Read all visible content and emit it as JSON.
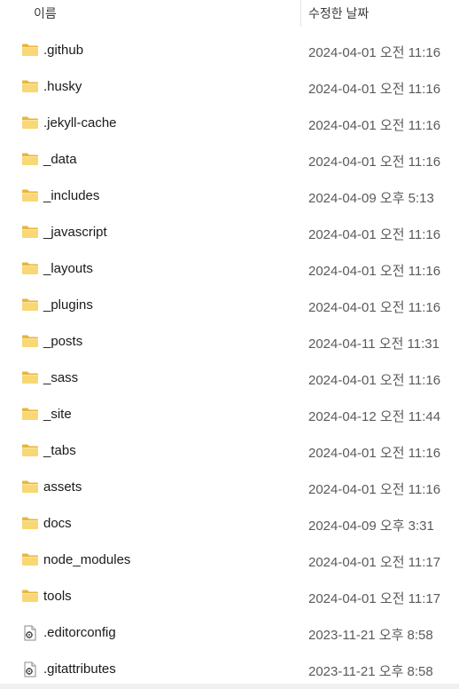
{
  "header": {
    "name_label": "이름",
    "date_label": "수정한 날짜",
    "sort_indicator": "^"
  },
  "rows": [
    {
      "name": ".github",
      "date": "2024-04-01 오전 11:16",
      "type": "folder"
    },
    {
      "name": ".husky",
      "date": "2024-04-01 오전 11:16",
      "type": "folder"
    },
    {
      "name": ".jekyll-cache",
      "date": "2024-04-01 오전 11:16",
      "type": "folder"
    },
    {
      "name": "_data",
      "date": "2024-04-01 오전 11:16",
      "type": "folder"
    },
    {
      "name": "_includes",
      "date": "2024-04-09 오후 5:13",
      "type": "folder"
    },
    {
      "name": "_javascript",
      "date": "2024-04-01 오전 11:16",
      "type": "folder"
    },
    {
      "name": "_layouts",
      "date": "2024-04-01 오전 11:16",
      "type": "folder"
    },
    {
      "name": "_plugins",
      "date": "2024-04-01 오전 11:16",
      "type": "folder"
    },
    {
      "name": "_posts",
      "date": "2024-04-11 오전 11:31",
      "type": "folder"
    },
    {
      "name": "_sass",
      "date": "2024-04-01 오전 11:16",
      "type": "folder"
    },
    {
      "name": "_site",
      "date": "2024-04-12 오전 11:44",
      "type": "folder"
    },
    {
      "name": "_tabs",
      "date": "2024-04-01 오전 11:16",
      "type": "folder"
    },
    {
      "name": "assets",
      "date": "2024-04-01 오전 11:16",
      "type": "folder"
    },
    {
      "name": "docs",
      "date": "2024-04-09 오후 3:31",
      "type": "folder"
    },
    {
      "name": "node_modules",
      "date": "2024-04-01 오전 11:17",
      "type": "folder"
    },
    {
      "name": "tools",
      "date": "2024-04-01 오전 11:17",
      "type": "folder"
    },
    {
      "name": ".editorconfig",
      "date": "2023-11-21 오후 8:58",
      "type": "config-file"
    },
    {
      "name": ".gitattributes",
      "date": "2023-11-21 오후 8:58",
      "type": "config-file"
    }
  ],
  "colors": {
    "folder_body": "#f8d775",
    "folder_tab": "#e8b63c",
    "date_text": "#5a5a5a"
  }
}
